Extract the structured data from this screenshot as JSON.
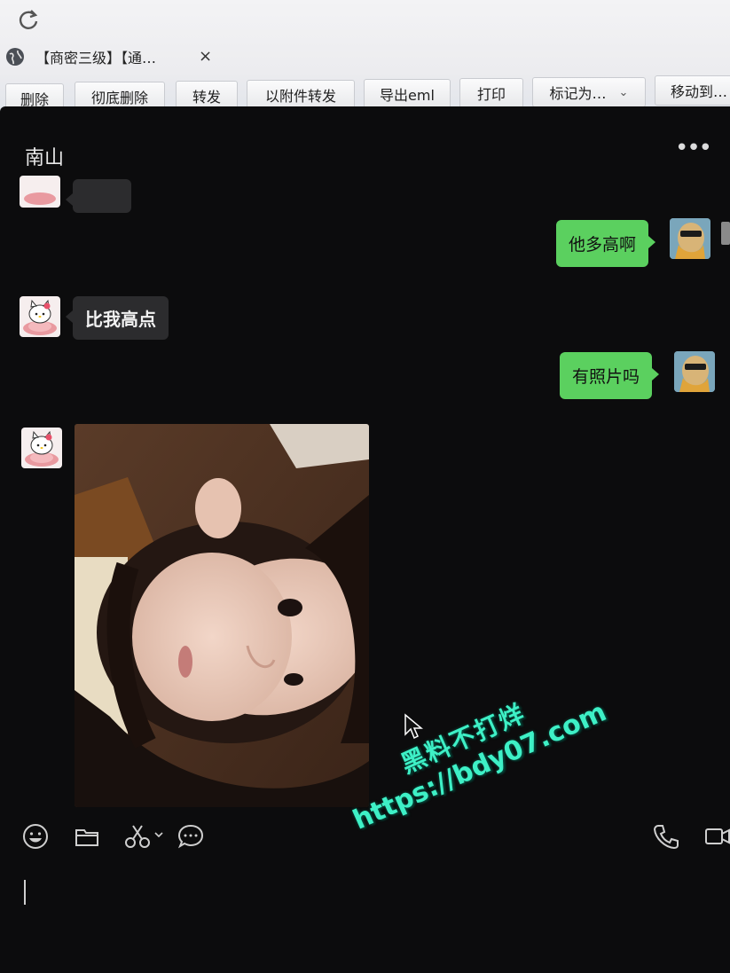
{
  "browser": {
    "tab_title": "【商密三级】【通…",
    "tab_close": "×",
    "icons": {
      "reload": "reload-icon",
      "site": "globe-icon"
    }
  },
  "toolbar": {
    "buttons": [
      {
        "label": "删除"
      },
      {
        "label": "彻底删除"
      },
      {
        "label": "转发"
      },
      {
        "label": "以附件转发"
      },
      {
        "label": "导出eml"
      },
      {
        "label": "打印"
      },
      {
        "label": "标记为…",
        "dropdown": true
      },
      {
        "label": "移动到…"
      }
    ]
  },
  "chat": {
    "title": "南山",
    "more_icon": "more-dots-icon",
    "colors": {
      "background": "#0c0c0d",
      "incoming_bubble": "#2c2c2e",
      "outgoing_bubble": "#5bd05f"
    },
    "messages": [
      {
        "side": "in",
        "type": "text",
        "text": "",
        "avatar": "hello-kitty-avatar"
      },
      {
        "side": "out",
        "type": "text",
        "text": "他多高啊",
        "avatar": "user-avatar"
      },
      {
        "side": "in",
        "type": "text",
        "text": "比我高点",
        "avatar": "hello-kitty-avatar"
      },
      {
        "side": "out",
        "type": "text",
        "text": "有照片吗",
        "avatar": "user-avatar"
      },
      {
        "side": "in",
        "type": "image",
        "avatar": "hello-kitty-avatar"
      }
    ],
    "input_icons": [
      "emoji-icon",
      "folder-icon",
      "scissors-icon",
      "chat-bubble-icon",
      "phone-icon",
      "video-icon"
    ]
  },
  "watermark": {
    "line1": "黑料不打烊",
    "line2": "https://bdy07.com"
  }
}
